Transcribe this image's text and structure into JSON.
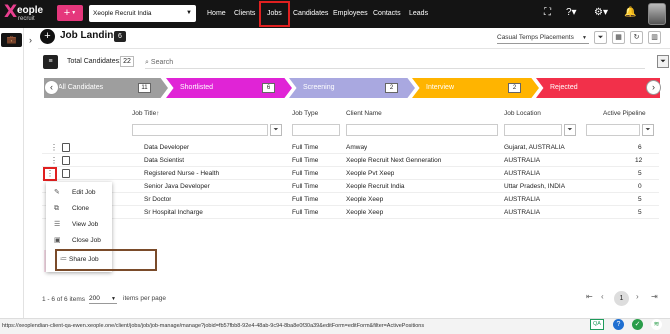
{
  "topbar": {
    "logo_mark": "X",
    "logo_word": "eople",
    "logo_sub": "recruit",
    "add_label": "+",
    "tenant": "Xeople Recruit India",
    "nav": [
      "Home",
      "Clients",
      "Jobs",
      "Candidates",
      "Employees",
      "Contacts",
      "Leads"
    ],
    "active_nav": "Jobs",
    "icons": [
      "fullscreen-icon",
      "help-icon",
      "settings-icon",
      "bell-icon",
      "avatar"
    ]
  },
  "page": {
    "title": "Job Landing",
    "count": "6",
    "view_dropdown": "Casual Temps Placements",
    "total_label": "Total Candidates:",
    "total_value": "22",
    "search_placeholder": "Search"
  },
  "pipeline": [
    {
      "label": "All Candidates",
      "count": "11",
      "color": "#9e9e9e"
    },
    {
      "label": "Shortlisted",
      "count": "6",
      "color": "#e024d6"
    },
    {
      "label": "Screening",
      "count": "2",
      "color": "#a9a8e0"
    },
    {
      "label": "Interview",
      "count": "2",
      "color": "#ffb400"
    },
    {
      "label": "Rejected",
      "count": "",
      "color": "#f2304a"
    }
  ],
  "grid": {
    "columns": [
      "Job Title",
      "Job Type",
      "Client Name",
      "Job Location",
      "Active Pipeline"
    ],
    "sort_arrow": "↑",
    "rows": [
      [
        "Data Developer",
        "Full Time",
        "Amway",
        "Gujarat, AUSTRALIA",
        "6"
      ],
      [
        "Data Scientist",
        "Full Time",
        "Xeople Recruit Next Genneration",
        "AUSTRALIA",
        "12"
      ],
      [
        "Registered Nurse - Health",
        "Full Time",
        "Xeople Pvt Xeep",
        "AUSTRALIA",
        "5"
      ],
      [
        "Senior Java Developer",
        "Full Time",
        "Xeople Recruit India",
        "Uttar Pradesh, INDIA",
        "0"
      ],
      [
        "Sr Doctor",
        "Full Time",
        "Xeople Xeep",
        "AUSTRALIA",
        "5"
      ],
      [
        "Sr Hospital Incharge",
        "Full Time",
        "Xeople Xeep",
        "AUSTRALIA",
        "5"
      ]
    ]
  },
  "context_menu": [
    "Edit Job",
    "Clone",
    "View Job",
    "Close Job",
    "Share Job"
  ],
  "pagination": {
    "range": "1 - 6 of 6 items",
    "per_page": "200",
    "per_page_label": "items per page",
    "current_page": "1"
  },
  "statusbar": {
    "url": "https://xeoplendian-client-qa-ewen.xeople.one/client/jobs/job/job-manage/manage?jobid=fb57fbb8-92e4-48ab-9c94-8ba8e0f30a39&editForm=editForm&filter=ActivePositions",
    "qa_label": "QA"
  },
  "colors": {
    "accent": "#e5377c",
    "topbar": "#141414",
    "highlight": "#e02020"
  }
}
